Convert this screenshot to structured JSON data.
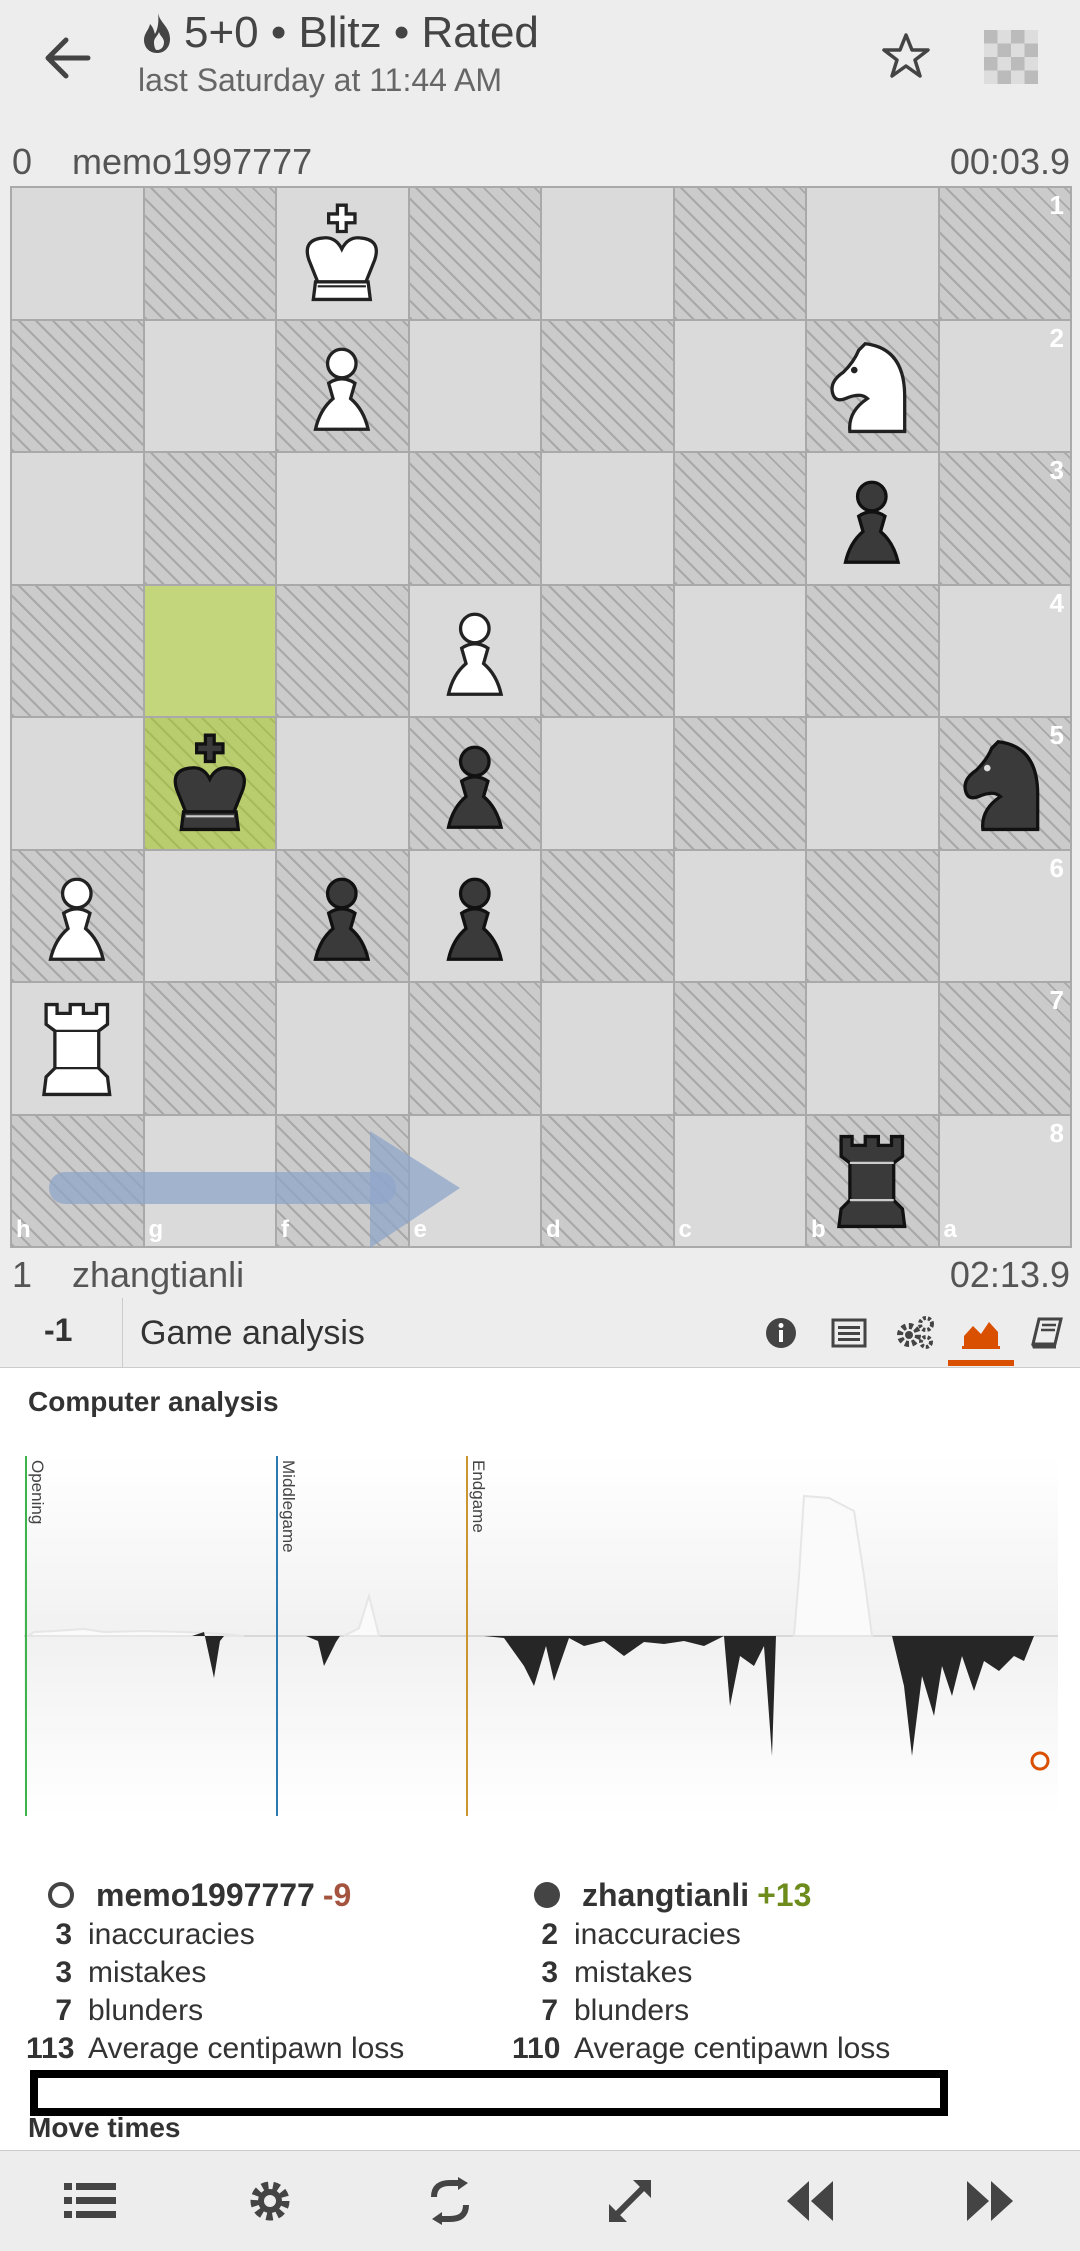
{
  "header": {
    "title": "5+0 • Blitz • Rated",
    "subtitle": "last Saturday at 11:44 AM",
    "icons": [
      "back-arrow-icon",
      "flame-icon",
      "star-icon",
      "board-thumbnail-icon"
    ]
  },
  "top_player": {
    "rating_diff": "0",
    "name": "memo1997777",
    "clock": "00:03.9"
  },
  "bottom_player": {
    "rating_diff": "1",
    "name": "zhangtianli",
    "clock": "02:13.9"
  },
  "board": {
    "ranks": [
      "1",
      "2",
      "3",
      "4",
      "5",
      "6",
      "7",
      "8"
    ],
    "files": [
      "h",
      "g",
      "f",
      "e",
      "d",
      "c",
      "b",
      "a"
    ],
    "pieces": [
      {
        "sq": "f1",
        "piece": "white-king"
      },
      {
        "sq": "f2",
        "piece": "white-pawn"
      },
      {
        "sq": "b2",
        "piece": "white-knight"
      },
      {
        "sq": "b3",
        "piece": "black-pawn"
      },
      {
        "sq": "e4",
        "piece": "white-pawn"
      },
      {
        "sq": "g5",
        "piece": "black-king"
      },
      {
        "sq": "e5",
        "piece": "black-pawn"
      },
      {
        "sq": "a5",
        "piece": "black-knight"
      },
      {
        "sq": "h6",
        "piece": "white-pawn"
      },
      {
        "sq": "f6",
        "piece": "black-pawn"
      },
      {
        "sq": "e6",
        "piece": "black-pawn"
      },
      {
        "sq": "h7",
        "piece": "white-rook"
      },
      {
        "sq": "b8",
        "piece": "black-rook"
      }
    ],
    "highlight": [
      "g4",
      "g5"
    ],
    "arrow": {
      "from": "h7",
      "to": "e7",
      "color": "#8fa6c9"
    }
  },
  "analysis_bar": {
    "eval": "-1",
    "title": "Game analysis",
    "tabs": [
      "info-icon",
      "notes-icon",
      "settings-gears-icon",
      "chart-icon",
      "book-icon"
    ],
    "active_tab": "chart-icon",
    "active_color": "#d85000"
  },
  "computer_analysis": {
    "title": "Computer analysis",
    "phases": [
      {
        "label": "Opening",
        "color": "#3bb54a"
      },
      {
        "label": "Middlegame",
        "color": "#2b7bb0"
      },
      {
        "label": "Endgame",
        "color": "#c99630"
      }
    ]
  },
  "players_stats": [
    {
      "name": "memo1997777",
      "rating_change": "-9",
      "change_color": "#a4533f",
      "side": "white",
      "inaccuracies": "3",
      "mistakes": "3",
      "blunders": "7",
      "acpl": "113"
    },
    {
      "name": "zhangtianli",
      "rating_change": "+13",
      "change_color": "#6e8c1c",
      "side": "black",
      "inaccuracies": "2",
      "mistakes": "3",
      "blunders": "7",
      "acpl": "110"
    }
  ],
  "labels": {
    "inaccuracies": "inaccuracies",
    "mistakes": "mistakes",
    "blunders": "blunders",
    "acpl": "Average centipawn loss",
    "move_times": "Move times"
  },
  "bottom_toolbar": [
    "menu-list-icon",
    "settings-gear-icon",
    "flip-board-icon",
    "expand-icon",
    "rewind-icon",
    "fast-forward-icon"
  ]
}
